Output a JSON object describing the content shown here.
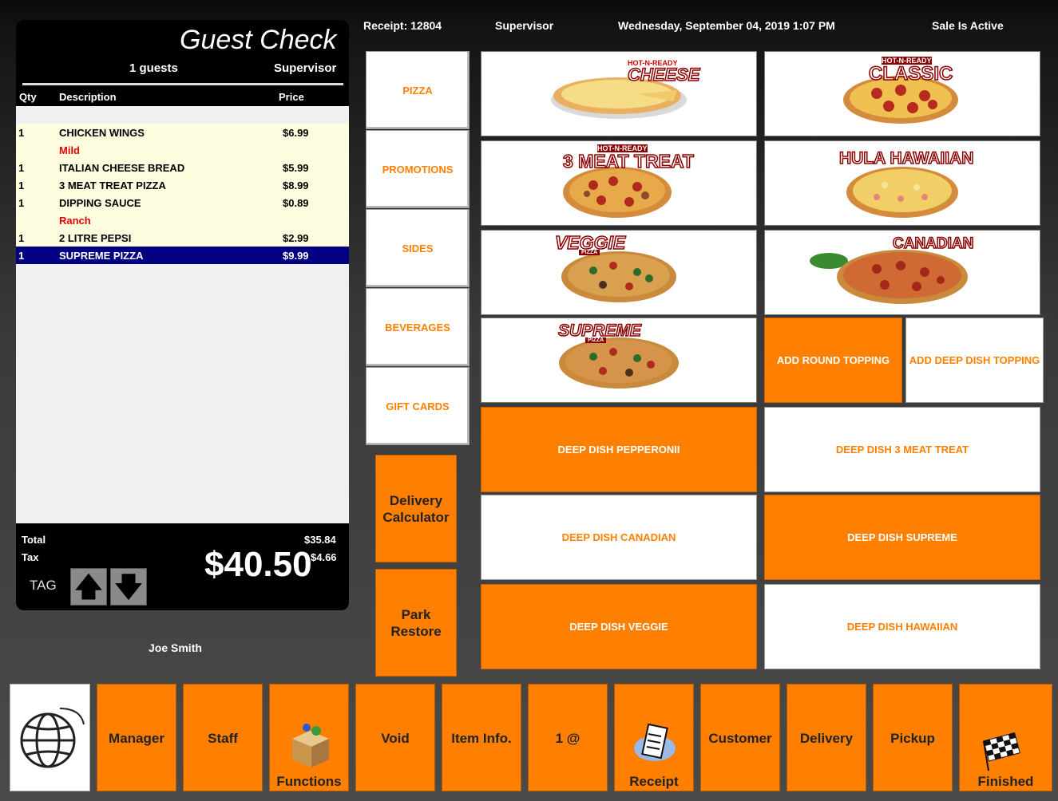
{
  "status_bar": {
    "receipt": "Receipt: 12804",
    "user": "Supervisor",
    "datetime": "Wednesday, September 04, 2019  1:07 PM",
    "sale_status": "Sale Is Active"
  },
  "guest_check": {
    "title": "Guest Check",
    "guests": "1 guests",
    "user": "Supervisor",
    "columns": {
      "qty": "Qty",
      "description": "Description",
      "price": "Price"
    },
    "items": [
      {
        "qty": "1",
        "desc": "CHICKEN WINGS",
        "price": "$6.99"
      },
      {
        "qty": "",
        "desc": "Mild",
        "price": "",
        "modifier": true
      },
      {
        "qty": "1",
        "desc": "ITALIAN CHEESE BREAD",
        "price": "$5.99"
      },
      {
        "qty": "1",
        "desc": "3 MEAT TREAT PIZZA",
        "price": "$8.99"
      },
      {
        "qty": "1",
        "desc": "DIPPING SAUCE",
        "price": "$0.89"
      },
      {
        "qty": "",
        "desc": "Ranch",
        "price": "",
        "modifier": true
      },
      {
        "qty": "1",
        "desc": "2 LITRE PEPSI",
        "price": "$2.99"
      },
      {
        "qty": "1",
        "desc": "SUPREME PIZZA",
        "price": "$9.99",
        "selected": true
      }
    ],
    "total_label": "Total",
    "total_value": "$35.84",
    "tax_label": "Tax",
    "tax_value": "$4.66",
    "grand_total": "$40.50",
    "tag_label": "TAG",
    "up_arrow": "🡅",
    "down_arrow": "🡇"
  },
  "staff_name": "Joe Smith",
  "categories": [
    "PIZZA",
    "PROMOTIONS",
    "SIDES",
    "BEVERAGES",
    "GIFT CARDS"
  ],
  "side_buttons": {
    "delivery_calculator": "Delivery Calculator",
    "park_restore": "Park Restore"
  },
  "products": {
    "cheese": "CHEESE",
    "cheese_tag": "HOT-N-READY",
    "classic": "CLASSIC",
    "classic_tag": "HOT-N-READY",
    "meat_treat": "3 MEAT TREAT",
    "meat_treat_tag": "HOT-N-READY",
    "hula_hawaiian": "HULA HAWAIIAN",
    "veggie": "VEGGIE",
    "veggie_sub": "PIZZA",
    "canadian": "CANADIAN",
    "supreme": "SUPREME",
    "supreme_sub": "PIZZA"
  },
  "tiles": {
    "add_round_topping": "ADD ROUND TOPPING",
    "add_deep_dish_topping": "ADD DEEP DISH TOPPING",
    "deep_dish_pepperoni": "DEEP DISH PEPPERONII",
    "deep_dish_3_meat_treat": "DEEP DISH 3 MEAT TREAT",
    "deep_dish_canadian": "DEEP DISH CANADIAN",
    "deep_dish_supreme": "DEEP DISH SUPREME",
    "deep_dish_veggie": "DEEP DISH VEGGIE",
    "deep_dish_hawaiian": "DEEP DISH HAWAIIAN"
  },
  "bottom_bar": {
    "manager": "Manager",
    "staff": "Staff",
    "functions": "Functions",
    "void": "Void",
    "item_info": "Item Info.",
    "qty_at": "1 @",
    "receipt": "Receipt",
    "customer": "Customer",
    "delivery": "Delivery",
    "pickup": "Pickup",
    "finished": "Finished"
  },
  "colors": {
    "accent": "#ff8000",
    "selected_row": "#000080",
    "modifier_text": "#e00000",
    "order_row_bg": "#fffde0"
  }
}
